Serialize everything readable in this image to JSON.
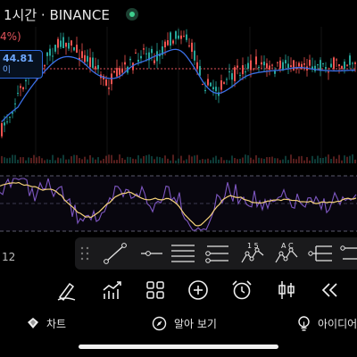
{
  "header": {
    "title": "1시간 · BINANCE",
    "change_pct": "4%)",
    "price_label": "44.81",
    "price_sub": "0|"
  },
  "chart": {
    "up_color": "#26a69a",
    "down_color": "#ef5350",
    "ma_color": "#3a6fe6",
    "rsi_color": "#7e57c2",
    "rsi_ma_color": "#f5d27a"
  },
  "time_axis": {
    "visible_label": "12"
  },
  "drawing_tools": [
    "trend-line-tool",
    "horizontal-ray-tool",
    "parallel-channel-tool",
    "fib-retracement-tool",
    "elliott-wave-tool",
    "abcd-pattern-tool",
    "pitchfork-tool",
    "measure-tool"
  ],
  "drawing_tool_labels": {
    "wave_top": "1 5",
    "abcd_top": "A C"
  },
  "toolbar": [
    "draw-icon",
    "indicators-icon",
    "layout-icon",
    "add-icon",
    "alarm-icon",
    "candles-icon",
    "rewind-icon"
  ],
  "tabs": {
    "chart": "차트",
    "explore": "알아 보기",
    "ideas": "아이디어"
  }
}
